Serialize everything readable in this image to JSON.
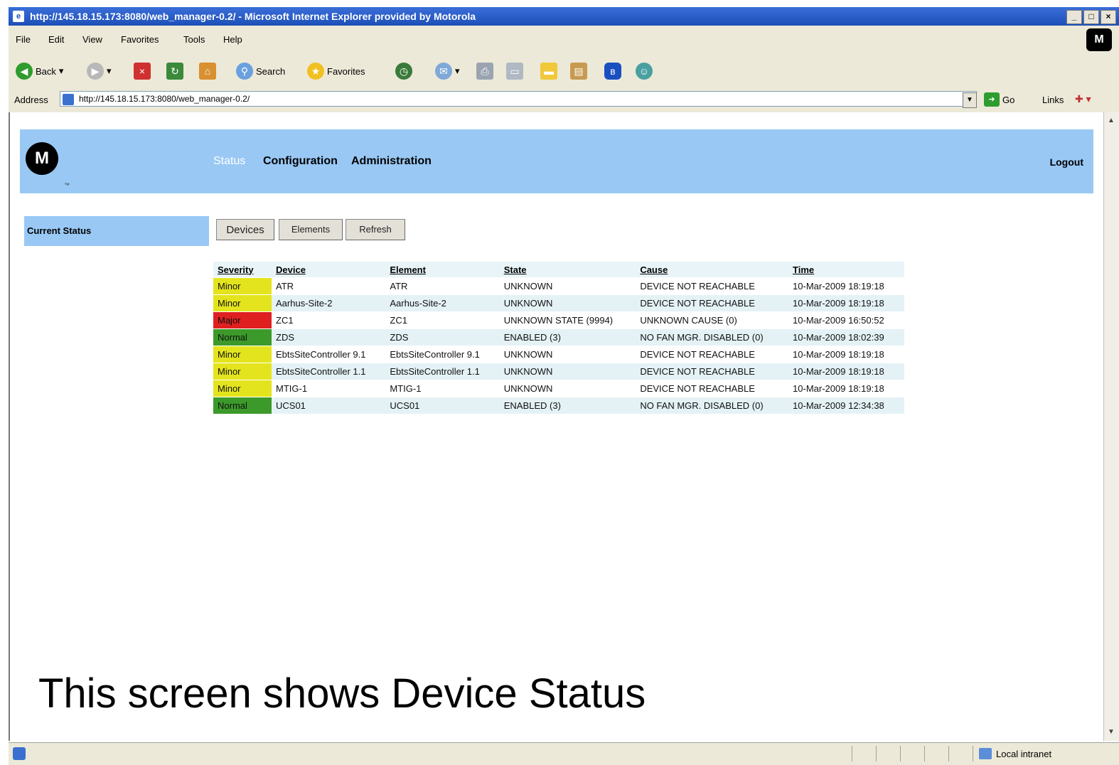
{
  "window": {
    "title": "http://145.18.15.173:8080/web_manager-0.2/ - Microsoft Internet Explorer provided by Motorola",
    "controls": [
      "_",
      "□",
      "×"
    ]
  },
  "menu": [
    "File",
    "Edit",
    "View",
    "Favorites",
    "Tools",
    "Help"
  ],
  "toolbar": {
    "back": "Back",
    "search": "Search",
    "favorites": "Favorites"
  },
  "address": {
    "label": "Address",
    "url": "http://145.18.15.173:8080/web_manager-0.2/",
    "go": "Go",
    "links": "Links"
  },
  "app": {
    "logo": "M",
    "nav": {
      "status": "Status",
      "configuration": "Configuration",
      "administration": "Administration",
      "logout": "Logout"
    },
    "sidebar": {
      "current_status": "Current Status"
    },
    "buttons": {
      "devices": "Devices",
      "elements": "Elements",
      "refresh": "Refresh"
    },
    "severity_colors": {
      "Minor": "#e4e41e",
      "Major": "#e02020",
      "Normal": "#3c9a2a"
    },
    "table": {
      "headers": [
        "Severity",
        "Device",
        "Element",
        "State",
        "Cause",
        "Time"
      ],
      "rows": [
        {
          "severity": "Minor",
          "device": "ATR",
          "element": "ATR",
          "state": "UNKNOWN",
          "cause": "DEVICE NOT REACHABLE",
          "time": "10-Mar-2009 18:19:18"
        },
        {
          "severity": "Minor",
          "device": "Aarhus-Site-2",
          "element": "Aarhus-Site-2",
          "state": "UNKNOWN",
          "cause": "DEVICE NOT REACHABLE",
          "time": "10-Mar-2009 18:19:18"
        },
        {
          "severity": "Major",
          "device": "ZC1",
          "element": "ZC1",
          "state": "UNKNOWN STATE (9994)",
          "cause": "UNKNOWN CAUSE (0)",
          "time": "10-Mar-2009 16:50:52"
        },
        {
          "severity": "Normal",
          "device": "ZDS",
          "element": "ZDS",
          "state": "ENABLED (3)",
          "cause": "NO FAN MGR. DISABLED (0)",
          "time": "10-Mar-2009 18:02:39"
        },
        {
          "severity": "Minor",
          "device": "EbtsSiteController 9.1",
          "element": "EbtsSiteController 9.1",
          "state": "UNKNOWN",
          "cause": "DEVICE NOT REACHABLE",
          "time": "10-Mar-2009 18:19:18"
        },
        {
          "severity": "Minor",
          "device": "EbtsSiteController 1.1",
          "element": "EbtsSiteController 1.1",
          "state": "UNKNOWN",
          "cause": "DEVICE NOT REACHABLE",
          "time": "10-Mar-2009 18:19:18"
        },
        {
          "severity": "Minor",
          "device": "MTIG-1",
          "element": "MTIG-1",
          "state": "UNKNOWN",
          "cause": "DEVICE NOT REACHABLE",
          "time": "10-Mar-2009 18:19:18"
        },
        {
          "severity": "Normal",
          "device": "UCS01",
          "element": "UCS01",
          "state": "ENABLED (3)",
          "cause": "NO FAN MGR. DISABLED (0)",
          "time": "10-Mar-2009 12:34:38"
        }
      ]
    }
  },
  "caption": "This screen shows Device Status",
  "statusbar": {
    "zone": "Local intranet"
  }
}
